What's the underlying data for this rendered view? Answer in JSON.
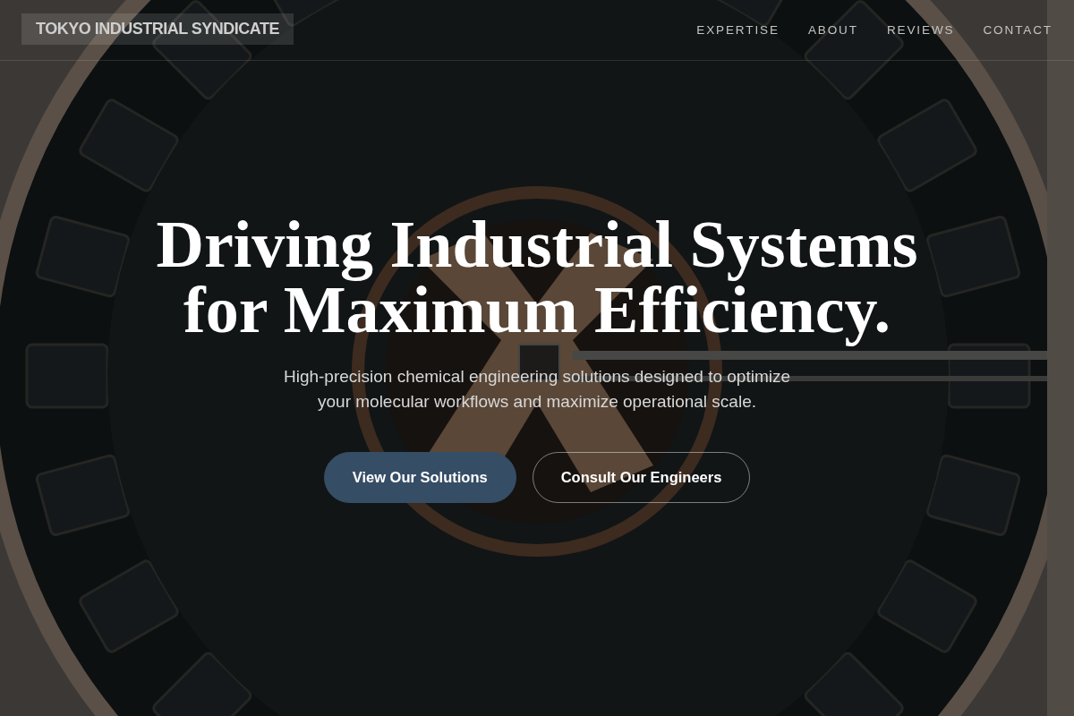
{
  "header": {
    "logo": "TOKYO INDUSTRIAL SYNDICATE",
    "nav": [
      "EXPERTISE",
      "ABOUT",
      "REVIEWS",
      "CONTACT"
    ]
  },
  "hero": {
    "heading": "Driving Industrial Systems for Maximum Efficiency.",
    "subtitle": "High-precision chemical engineering solutions designed to optimize your molecular workflows and maximize operational scale.",
    "buttons": [
      {
        "label": "View Our Solutions",
        "kind": "primary"
      },
      {
        "label": "Consult Our Engineers",
        "kind": "outline"
      }
    ]
  }
}
